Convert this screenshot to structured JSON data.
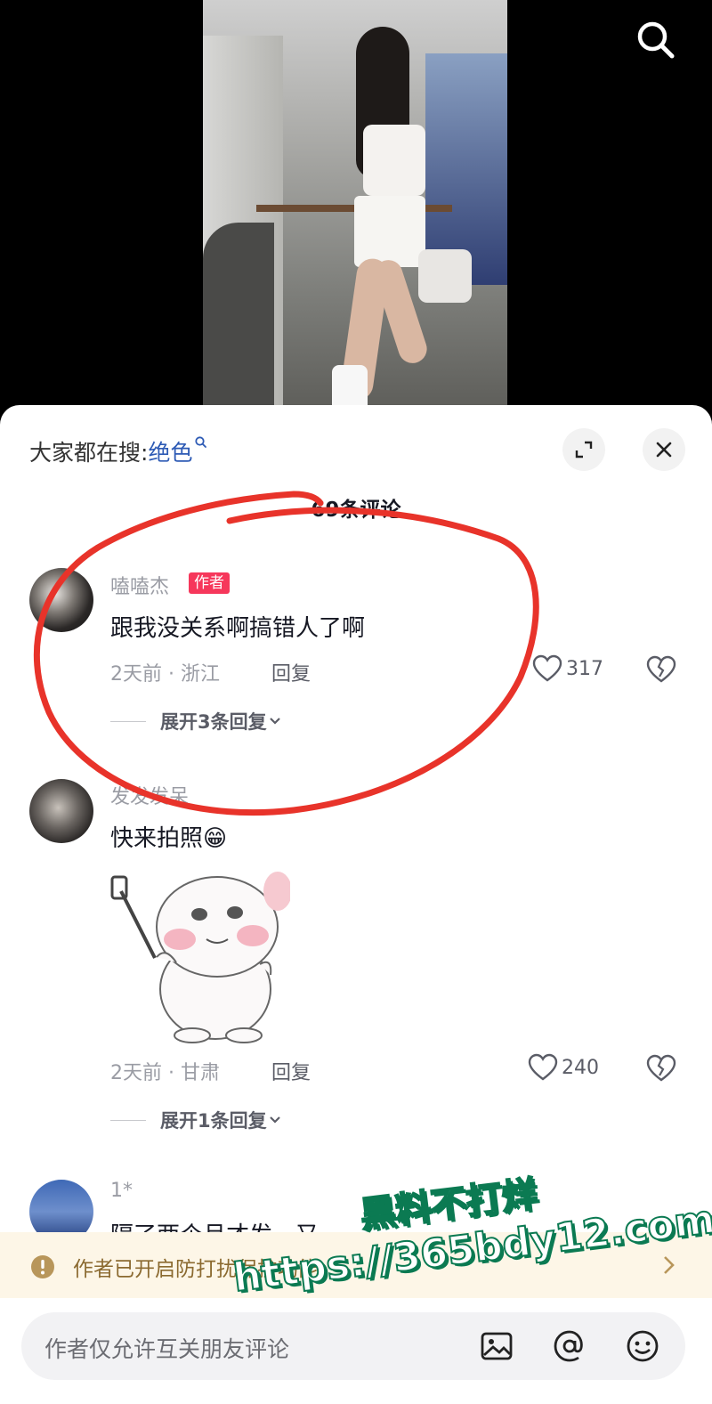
{
  "sheet": {
    "trending_prefix": "大家都在搜:",
    "trending_keyword": "绝色",
    "comment_count": "69条评论"
  },
  "comments": [
    {
      "username": "嗑嗑杰",
      "author_tag": "作者",
      "text": "跟我没关系啊搞错人了啊",
      "meta": "2天前 · 浙江",
      "reply": "回复",
      "likes": "317",
      "expand": "展开3条回复"
    },
    {
      "username": "发发发呆",
      "text": "快来拍照😁",
      "meta": "2天前 · 甘肃",
      "reply": "回复",
      "likes": "240",
      "expand": "展开1条回复"
    },
    {
      "username": "1*",
      "text": "隔了两个月才发，又一"
    }
  ],
  "notice": {
    "text": "作者已开启防打扰保护功能"
  },
  "input": {
    "placeholder": "作者仅允许互关朋友评论"
  },
  "watermark": {
    "line1": "黑料不打烊",
    "line2": "https://365bdy12.com"
  },
  "colors": {
    "author_tag": "#f6375b",
    "keyword": "#2e5bb5",
    "annotation_red": "#e8332a",
    "notice_bg": "#fdf6e7",
    "watermark_stroke": "#0b7a52"
  }
}
